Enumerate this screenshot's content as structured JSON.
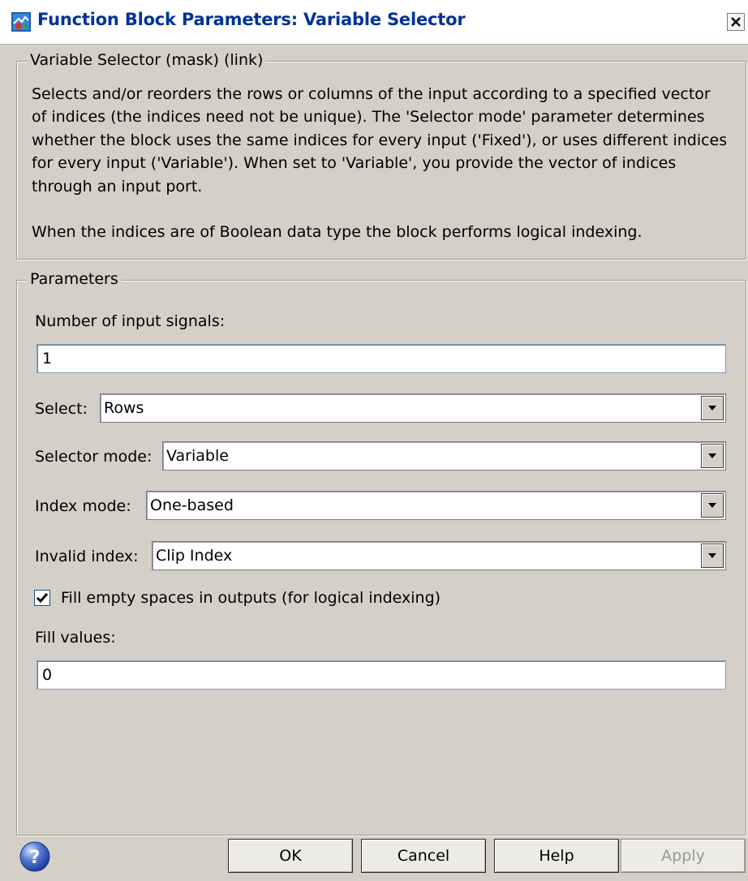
{
  "window": {
    "title": "Function Block Parameters: Variable Selector"
  },
  "description_group": {
    "legend": "Variable Selector (mask) (link)",
    "paragraph1": "Selects and/or reorders the rows or columns of the input according to a specified vector of indices (the indices need not be unique). The 'Selector mode' parameter determines whether the block uses the same indices for every input ('Fixed'), or uses different indices for every input ('Variable'). When set to 'Variable', you provide the vector of indices through an input port.",
    "paragraph2": "When the indices are of Boolean data type the block performs logical indexing."
  },
  "parameters": {
    "legend": "Parameters",
    "num_inputs_label": "Number of input signals:",
    "num_inputs_value": "1",
    "select_label": "Select:",
    "select_value": "Rows",
    "selector_mode_label": "Selector mode:",
    "selector_mode_value": "Variable",
    "index_mode_label": "Index mode:",
    "index_mode_value": "One-based",
    "invalid_index_label": "Invalid index:",
    "invalid_index_value": "Clip Index",
    "fill_empty_label": "Fill empty spaces in outputs (for logical indexing)",
    "fill_empty_checked": true,
    "fill_values_label": "Fill values:",
    "fill_values_value": "0"
  },
  "buttons": {
    "ok": "OK",
    "cancel": "Cancel",
    "help": "Help",
    "apply": "Apply"
  },
  "icons": {
    "app": "simulink-block-icon",
    "close": "close-icon",
    "help": "question-icon",
    "dropdown": "chevron-down-icon",
    "check": "check-icon"
  },
  "colors": {
    "title_text": "#003399",
    "dialog_bg": "#d4d0c8"
  }
}
